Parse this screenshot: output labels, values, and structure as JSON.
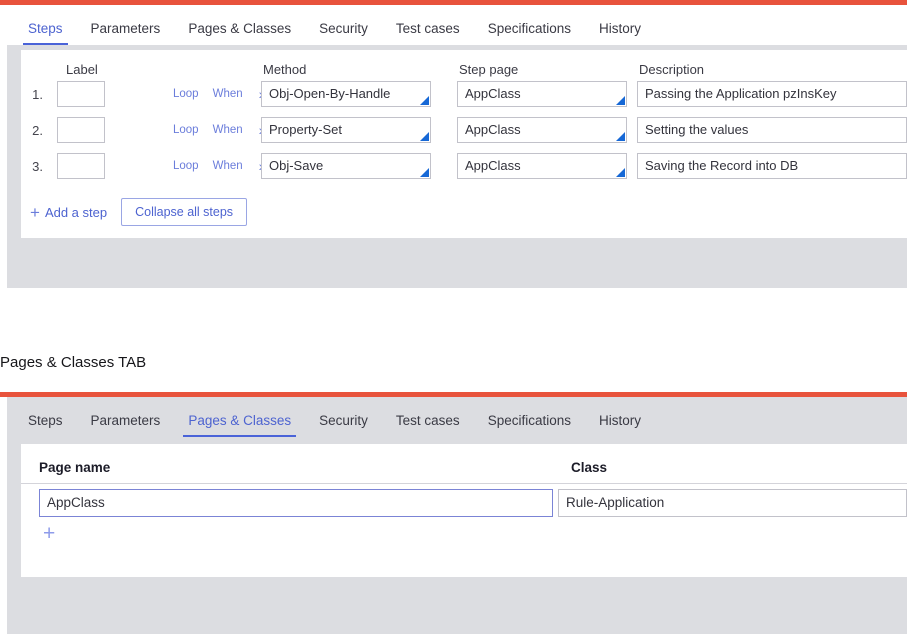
{
  "theme": {
    "accent_red": "#e8533c",
    "accent_blue": "#4a63d8",
    "link_blue": "#6b7ddb",
    "triangle_blue": "#1668d6",
    "panel_bg": "#dcdde1",
    "card_bg": "#ffffff"
  },
  "steps_panel": {
    "tabs": [
      {
        "label": "Steps",
        "active": true
      },
      {
        "label": "Parameters",
        "active": false
      },
      {
        "label": "Pages & Classes",
        "active": false
      },
      {
        "label": "Security",
        "active": false
      },
      {
        "label": "Test cases",
        "active": false
      },
      {
        "label": "Specifications",
        "active": false
      },
      {
        "label": "History",
        "active": false
      }
    ],
    "columns": {
      "label": "Label",
      "method": "Method",
      "step_page": "Step page",
      "description": "Description"
    },
    "rows": [
      {
        "number": "1.",
        "label_value": "",
        "loop": "Loop",
        "when": "When",
        "chevron": "›",
        "method": "Obj-Open-By-Handle",
        "step_page": "AppClass",
        "description": "Passing the Application pzInsKey"
      },
      {
        "number": "2.",
        "label_value": "",
        "loop": "Loop",
        "when": "When",
        "chevron": "›",
        "method": "Property-Set",
        "step_page": "AppClass",
        "description": "Setting the values"
      },
      {
        "number": "3.",
        "label_value": "",
        "loop": "Loop",
        "when": "When",
        "chevron": "›",
        "method": "Obj-Save",
        "step_page": "AppClass",
        "description": "Saving the Record into DB"
      }
    ],
    "actions": {
      "add_step_plus": "+",
      "add_step_label": "Add a step",
      "collapse_label": "Collapse all steps"
    }
  },
  "section_caption": "Pages & Classes TAB",
  "pages_panel": {
    "tabs": [
      {
        "label": "Steps",
        "active": false
      },
      {
        "label": "Parameters",
        "active": false
      },
      {
        "label": "Pages & Classes",
        "active": true
      },
      {
        "label": "Security",
        "active": false
      },
      {
        "label": "Test cases",
        "active": false
      },
      {
        "label": "Specifications",
        "active": false
      },
      {
        "label": "History",
        "active": false
      }
    ],
    "columns": {
      "page_name": "Page name",
      "class": "Class"
    },
    "rows": [
      {
        "page_name": "AppClass",
        "class": "Rule-Application"
      }
    ],
    "add_row_plus": "+"
  }
}
